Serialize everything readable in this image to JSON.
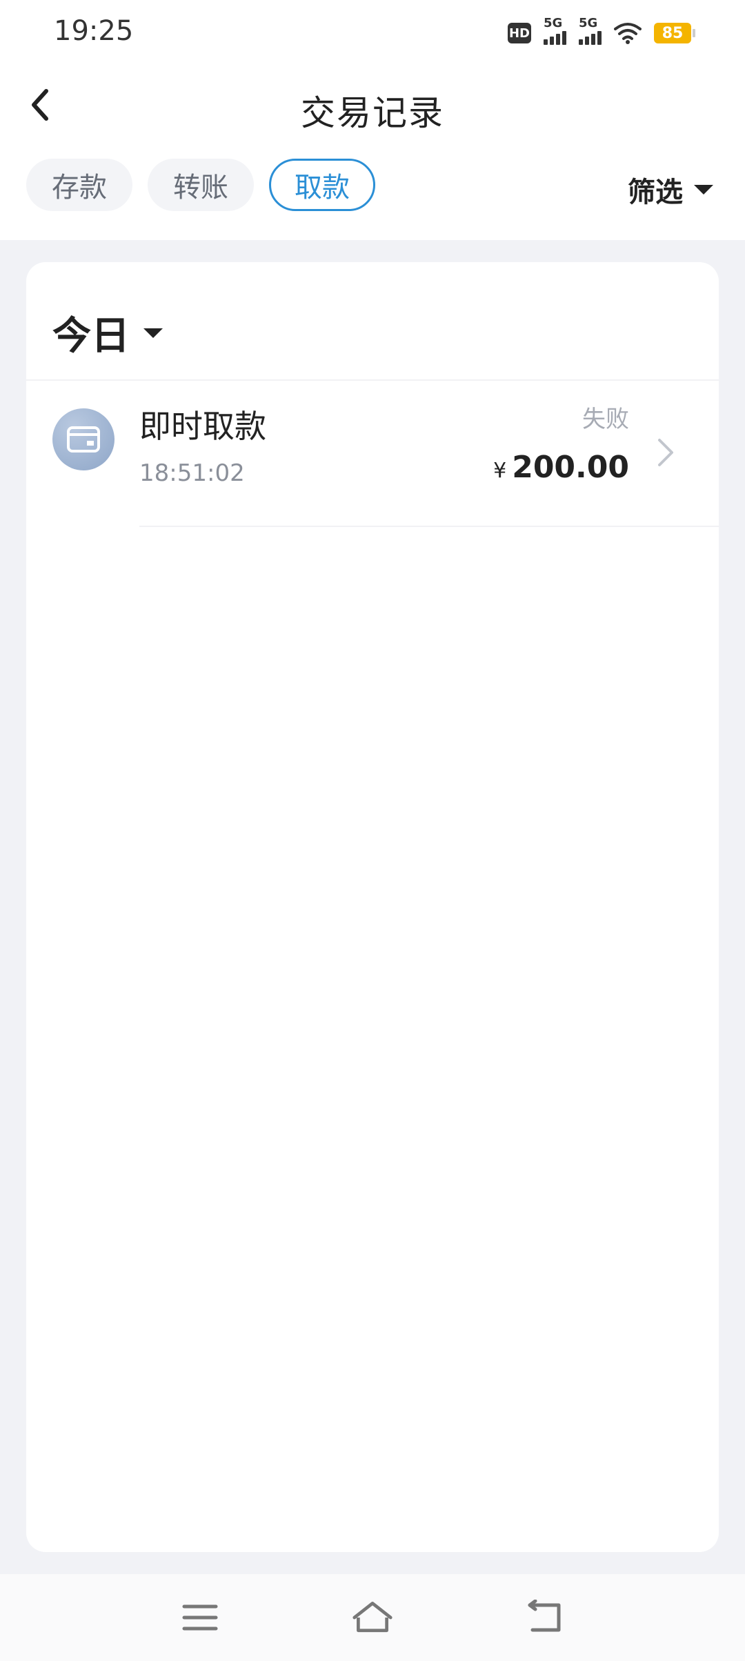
{
  "status_bar": {
    "time": "19:25",
    "hd": "HD",
    "network1": "5G",
    "network2": "5G",
    "battery": "85"
  },
  "header": {
    "title": "交易记录",
    "tabs": [
      {
        "label": "存款",
        "active": false
      },
      {
        "label": "转账",
        "active": false
      },
      {
        "label": "取款",
        "active": true
      }
    ],
    "filter_label": "筛选"
  },
  "list": {
    "day_label": "今日",
    "transactions": [
      {
        "title": "即时取款",
        "time": "18:51:02",
        "status": "失败",
        "currency": "¥",
        "amount": "200.00"
      }
    ]
  },
  "colors": {
    "accent": "#2b8fd6",
    "background": "#f1f2f6",
    "battery": "#f4b400"
  },
  "icons": {
    "back": "chevron-left-icon",
    "filter_caret": "caret-down-icon",
    "txn": "card-icon",
    "row_arrow": "chevron-right-icon",
    "nav_menu": "menu-icon",
    "nav_home": "home-icon",
    "nav_back": "return-icon"
  }
}
